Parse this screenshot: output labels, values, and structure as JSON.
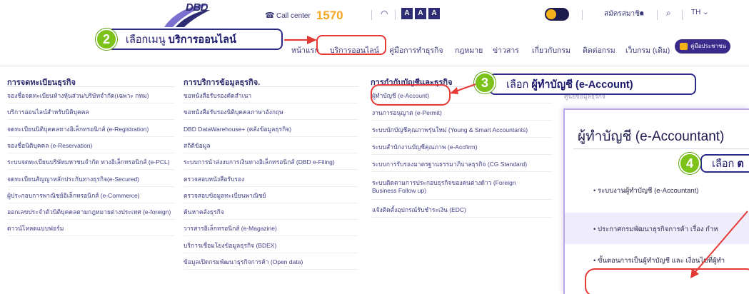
{
  "header": {
    "logo_text": "DBD",
    "callcenter_label": "Call center",
    "callcenter_number": "1570",
    "font_sizes": [
      "A",
      "A",
      "A"
    ],
    "member_label": "สมัครสมาชิก",
    "lang_label": "TH"
  },
  "nav": {
    "items": [
      "หน้าแรก",
      "บริการออนไลน์",
      "คู่มือการทำธุรกิจ",
      "กฎหมาย",
      "ข่าวสาร",
      "เกี่ยวกับกรม",
      "ติดต่อกรม",
      "เว็บกรม (เดิม)"
    ],
    "manual_label": "คู่มือประชาชน"
  },
  "menu": {
    "col1": {
      "heading": "การจดทะเบียนธุรกิจ",
      "items": [
        "จองชื่อจดทะเบียนห้างหุ้นส่วน/บริษัทจำกัด(เฉพาะ กทม)",
        "บริการออนไลน์สำหรับนิติบุคคล",
        "จดทะเบียนนิติบุคคลทางอิเล็กทรอนิกส์ (e-Registration)",
        "จองชื่อนิติบุคคล (e-Reservation)",
        "ระบบจดทะเบียนบริษัทมหาชนจำกัด ทางอิเล็กทรอนิกส์ (e-PCL)",
        "จดทะเบียนสัญญาหลักประกันทางธุรกิจ(e-Secured)",
        "ผู้ประกอบการพาณิชย์อิเล็กทรอนิกส์ (e-Commerce)",
        "ออกเลขประจำตัวนิติบุคคลตามกฎหมายต่างประเทศ (e-foreign)",
        "ดาวน์โหลดแบบฟอร์ม"
      ]
    },
    "col2": {
      "heading": "การบริการข้อมูลธุรกิจ.",
      "items": [
        "ขอหนังสือรับรองคัดสำเนา",
        "ขอหนังสือรับรองนิติบุคคลภาษาอังกฤษ",
        "DBD DataWarehouse+ (คลังข้อมูลธุรกิจ)",
        "สถิติข้อมูล",
        "ระบบการนำส่งงบการเงินทางอิเล็กทรอนิกส์ (DBD e-Filing)",
        "ตรวจสอบหนังสือรับรอง",
        "ตรวจสอบข้อมูลทะเบียนพาณิชย์",
        "ค้นหาคลังธุรกิจ",
        "วารสารอิเล็กทรอนิกส์ (e-Magazine)",
        "บริการเชื่อมโยงข้อมูลธุรกิจ (BDEX)",
        "ข้อมูลเปิดกรมพัฒนาธุรกิจการค้า (Open data)"
      ]
    },
    "col3": {
      "heading": "การกำกับบัญชีและธุรกิจ",
      "items": [
        "ผู้ทำบัญชี (e-Account)",
        "งานการอนุญาต (e-Permit)",
        "ระบบนักบัญชีคุณภาพรุ่นใหม่ (Young & Smart Accountants)",
        "ระบบสำนักงานบัญชีคุณภาพ (e-Accfirm)",
        "ระบบการรับรองมาตรฐานธรรมาภิบาลธุรกิจ (CG Standard)",
        "ระบบติดตามการประกอบธุรกิจของคนต่างด้าว (Foreign",
        "Business Follow up)",
        "แจ้งติดตั้งอุปกรณ์รับชำระเงิน (EDC)"
      ]
    },
    "col4_peek": [
      "ศูนย์ข้อมูลธุรกิจ"
    ]
  },
  "callouts": {
    "step2": {
      "num": "2",
      "prefix": "เลือกเมนู ",
      "bold": "บริการออนไลน์"
    },
    "step3": {
      "num": "3",
      "prefix": "เลือก ",
      "bold": "ผู้ทำบัญชี (e-Account)"
    },
    "step4": {
      "num": "4",
      "prefix": "เลือก ",
      "bold": "ต"
    }
  },
  "panel": {
    "title": "ผู้ทำบัญชี (e-Accountant)",
    "items": [
      "• ระบบงานผู้ทำบัญชี (e-Accountant)",
      "• ประกาศกรมพัฒนาธุรกิจการค้า เรื่อง กำห",
      "• ขั้นตอนการเป็นผู้ทำบัญชี และ เงื่อนไขที่ผู้ทำ"
    ]
  },
  "colors": {
    "brand": "#2b2a6b",
    "accent": "#f5a623",
    "highlight": "#e53935",
    "step": "#7cc21b"
  }
}
